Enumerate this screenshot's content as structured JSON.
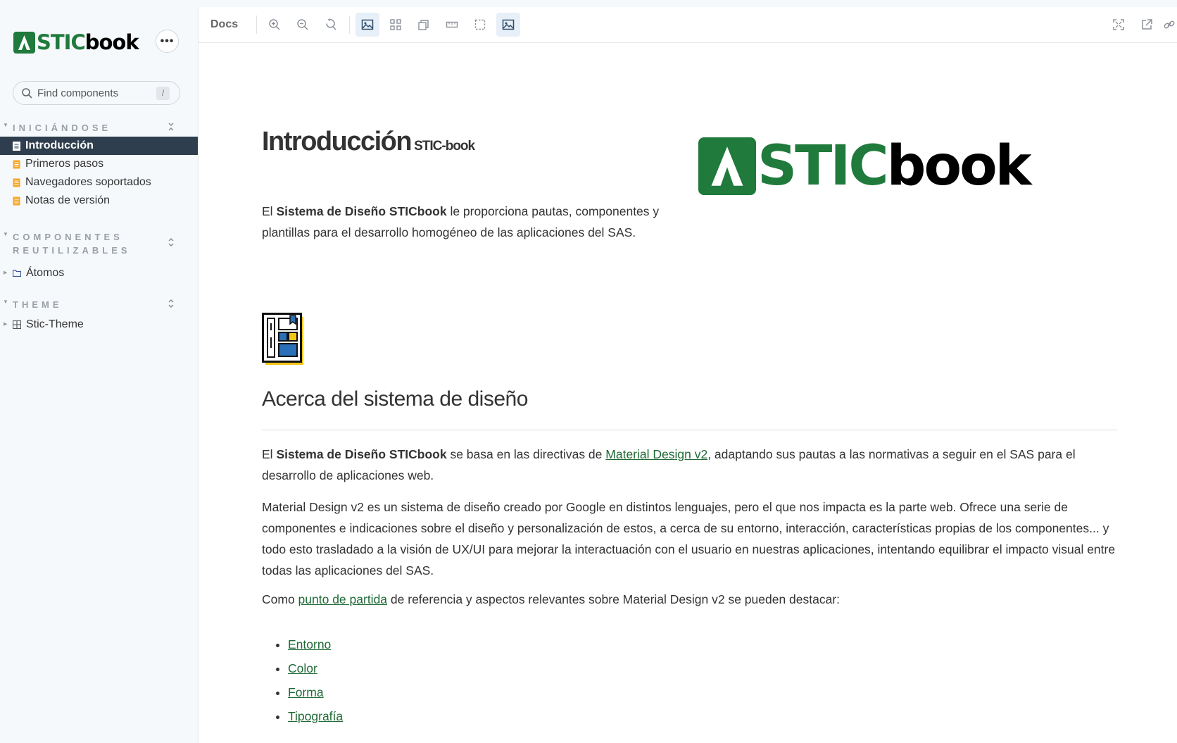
{
  "brand": {
    "prefix_letter": "A",
    "green": "STIC",
    "black": "book"
  },
  "sidebar": {
    "more_label": "•••",
    "search": {
      "placeholder": "Find components",
      "shortcut": "/"
    },
    "sections": [
      {
        "title": "INICIÁNDOSE",
        "items": [
          "Introducción",
          "Primeros pasos",
          "Navegadores soportados",
          "Notas de versión"
        ]
      },
      {
        "title_line1": "COMPONENTES",
        "title_line2": "REUTILIZABLES",
        "items": [
          "Átomos"
        ]
      },
      {
        "title": "THEME",
        "items": [
          "Stic-Theme"
        ]
      }
    ]
  },
  "toolbar": {
    "docs_label": "Docs"
  },
  "content": {
    "title": "Introducción",
    "subtitle": "STIC-book",
    "intro_prefix": "El ",
    "intro_bold": "Sistema de Diseño STICbook",
    "intro_rest": " le proporciona pautas, componentes y plantillas para el desarrollo homogéneo de las aplicaciones del SAS.",
    "about_heading": "Acerca del sistema de diseño",
    "p1_prefix": "El ",
    "p1_bold": "Sistema de Diseño STICbook",
    "p1_mid": " se basa en las directivas de ",
    "p1_link": "Material Design v2",
    "p1_rest": ", adaptando sus pautas a las normativas a seguir en el SAS para el desarrollo de aplicaciones web.",
    "p2": "Material Design v2 es un sistema de diseño creado por Google en distintos lenguajes, pero el que nos impacta es la parte web. Ofrece una serie de componentes e indicaciones sobre el diseño y personalización de estos, a cerca de su entorno, interacción, características propias de los componentes... y todo esto trasladado a la visión de UX/UI para mejorar la interactuación con el usuario en nuestras aplicaciones, intentando equilibrar el impacto visual entre todas las aplicaciones del SAS.",
    "p3_prefix": "Como ",
    "p3_link": "punto de partida",
    "p3_rest": " de referencia y aspectos relevantes sobre Material Design v2 se pueden destacar:",
    "links": [
      "Entorno",
      "Color",
      "Forma",
      "Tipografía"
    ]
  },
  "colors": {
    "brand_green": "#1f7a3c",
    "active_nav": "#2f3e4e",
    "link": "#1f6a36"
  }
}
